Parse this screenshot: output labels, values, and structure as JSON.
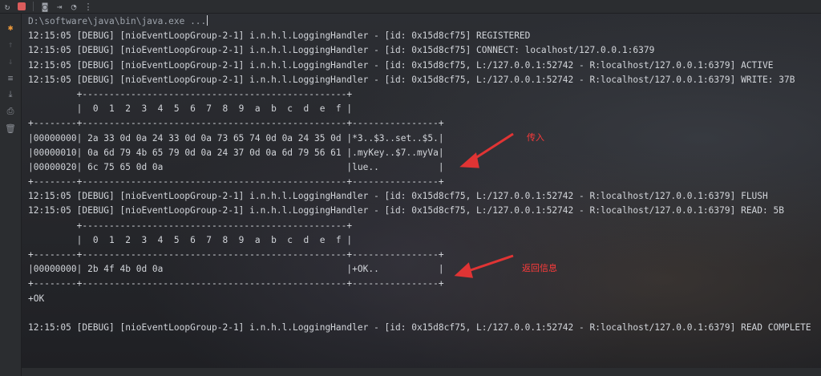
{
  "toolbar": {
    "icons": [
      "rerun-icon",
      "stop-icon",
      "screenshot-icon",
      "exit-icon",
      "profiler-icon"
    ]
  },
  "gutter": {
    "icons": [
      "console-icon",
      "scroll-up-icon",
      "scroll-down-icon",
      "soft-wrap-icon",
      "scroll-to-end-icon",
      "print-icon",
      "trash-icon"
    ]
  },
  "console": {
    "lines": [
      "D:\\software\\java\\bin\\java.exe ...",
      "12:15:05 [DEBUG] [nioEventLoopGroup-2-1] i.n.h.l.LoggingHandler - [id: 0x15d8cf75] REGISTERED",
      "12:15:05 [DEBUG] [nioEventLoopGroup-2-1] i.n.h.l.LoggingHandler - [id: 0x15d8cf75] CONNECT: localhost/127.0.0.1:6379",
      "12:15:05 [DEBUG] [nioEventLoopGroup-2-1] i.n.h.l.LoggingHandler - [id: 0x15d8cf75, L:/127.0.0.1:52742 - R:localhost/127.0.0.1:6379] ACTIVE",
      "12:15:05 [DEBUG] [nioEventLoopGroup-2-1] i.n.h.l.LoggingHandler - [id: 0x15d8cf75, L:/127.0.0.1:52742 - R:localhost/127.0.0.1:6379] WRITE: 37B",
      "         +-------------------------------------------------+",
      "         |  0  1  2  3  4  5  6  7  8  9  a  b  c  d  e  f |",
      "+--------+-------------------------------------------------+----------------+",
      "|00000000| 2a 33 0d 0a 24 33 0d 0a 73 65 74 0d 0a 24 35 0d |*3..$3..set..$5.|",
      "|00000010| 0a 6d 79 4b 65 79 0d 0a 24 37 0d 0a 6d 79 56 61 |.myKey..$7..myVa|",
      "|00000020| 6c 75 65 0d 0a                                  |lue..           |",
      "+--------+-------------------------------------------------+----------------+",
      "12:15:05 [DEBUG] [nioEventLoopGroup-2-1] i.n.h.l.LoggingHandler - [id: 0x15d8cf75, L:/127.0.0.1:52742 - R:localhost/127.0.0.1:6379] FLUSH",
      "12:15:05 [DEBUG] [nioEventLoopGroup-2-1] i.n.h.l.LoggingHandler - [id: 0x15d8cf75, L:/127.0.0.1:52742 - R:localhost/127.0.0.1:6379] READ: 5B",
      "         +-------------------------------------------------+",
      "         |  0  1  2  3  4  5  6  7  8  9  a  b  c  d  e  f |",
      "+--------+-------------------------------------------------+----------------+",
      "|00000000| 2b 4f 4b 0d 0a                                  |+OK..           |",
      "+--------+-------------------------------------------------+----------------+",
      "+OK",
      "",
      "12:15:05 [DEBUG] [nioEventLoopGroup-2-1] i.n.h.l.LoggingHandler - [id: 0x15d8cf75, L:/127.0.0.1:52742 - R:localhost/127.0.0.1:6379] READ COMPLETE"
    ]
  },
  "annotations": {
    "incoming": "传入",
    "response": "返回信息",
    "color": "#ff3b3b"
  }
}
